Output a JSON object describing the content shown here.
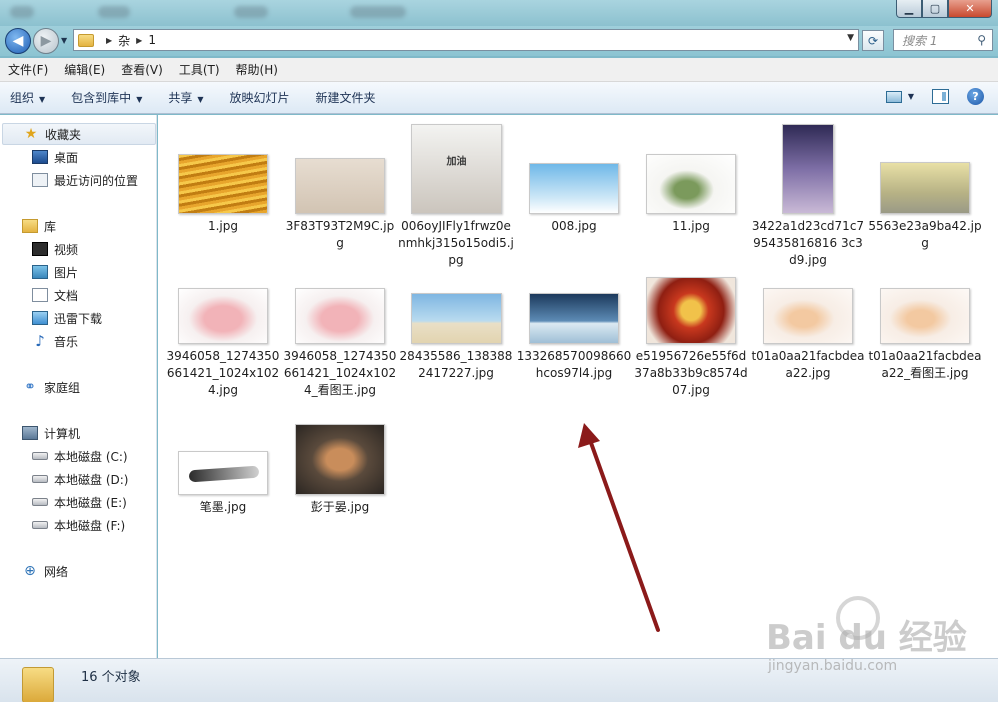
{
  "address": {
    "crumbs": [
      "杂",
      "1"
    ],
    "search_placeholder": "搜索 1"
  },
  "menu": [
    "文件(F)",
    "编辑(E)",
    "查看(V)",
    "工具(T)",
    "帮助(H)"
  ],
  "toolbar": {
    "organize": "组织",
    "include_in_library": "包含到库中",
    "share": "共享",
    "slideshow": "放映幻灯片",
    "new_folder": "新建文件夹"
  },
  "nav": {
    "favorites": "收藏夹",
    "desktop": "桌面",
    "recent": "最近访问的位置",
    "libraries": "库",
    "videos": "视频",
    "pictures": "图片",
    "documents": "文档",
    "thunder": "迅雷下载",
    "music": "音乐",
    "homegroup": "家庭组",
    "computer": "计算机",
    "drive_c": "本地磁盘 (C:)",
    "drive_d": "本地磁盘 (D:)",
    "drive_e": "本地磁盘 (E:)",
    "drive_f": "本地磁盘 (F:)",
    "network": "网络"
  },
  "files": [
    {
      "name": "1.jpg"
    },
    {
      "name": "3F83T93T2M9C.jpg"
    },
    {
      "name": "006oyJIFly1frwz0enmhkj315o15odi5.jpg"
    },
    {
      "name": "008.jpg"
    },
    {
      "name": "11.jpg"
    },
    {
      "name": "3422a1d23cd71c795435816816 3c3d9.jpg"
    },
    {
      "name": "5563e23a9ba42.jpg"
    },
    {
      "name": "3946058_1274350661421_1024x1024.jpg"
    },
    {
      "name": "3946058_1274350661421_1024x1024_看图王.jpg"
    },
    {
      "name": "28435586_1383882417227.jpg"
    },
    {
      "name": "133268570098660hcos97l4.jpg"
    },
    {
      "name": "e51956726e55f6d37a8b33b9c8574d07.jpg"
    },
    {
      "name": "t01a0aa21facbdeaa22.jpg"
    },
    {
      "name": "t01a0aa21facbdeaa22_看图王.jpg"
    },
    {
      "name": "笔墨.jpg"
    },
    {
      "name": "彭于晏.jpg"
    }
  ],
  "thumb_text": {
    "cup": "加油"
  },
  "status": {
    "count": "16 个对象"
  },
  "watermark": {
    "brand": "Bai du 经验",
    "url": "jingyan.baidu.com"
  },
  "colors": {
    "window_frame": "#8cc4d2",
    "toolbar_text": "#1e3355",
    "arrow": "#8b1a1a"
  }
}
